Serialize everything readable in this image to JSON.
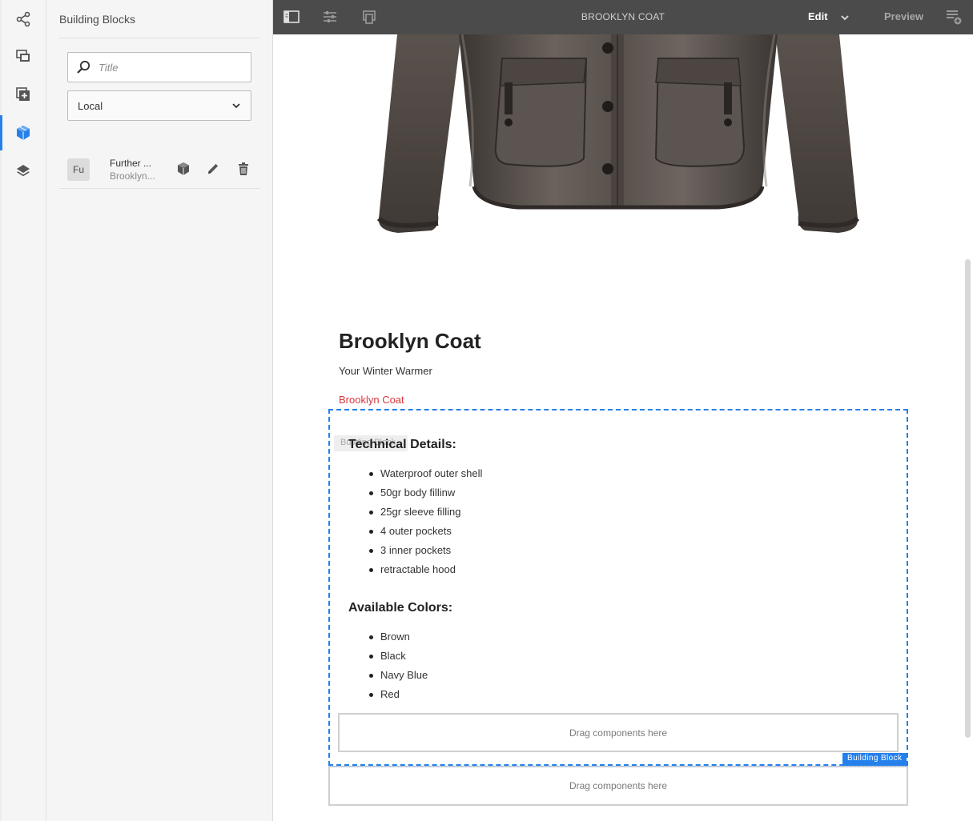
{
  "rail": {
    "items": [
      {
        "icon": "share-icon"
      },
      {
        "icon": "assets-icon"
      },
      {
        "icon": "add-component-icon"
      },
      {
        "icon": "building-blocks-icon",
        "active": true
      },
      {
        "icon": "layers-icon"
      }
    ]
  },
  "panel": {
    "title": "Building Blocks",
    "search_placeholder": "Title",
    "filter_value": "Local",
    "items": [
      {
        "thumb": "Fu",
        "title": "Further ...",
        "subtitle": "Brooklyn..."
      }
    ]
  },
  "topbar": {
    "page_title": "BROOKLYN COAT",
    "mode": "Edit",
    "preview": "Preview"
  },
  "content": {
    "title": "Brooklyn Coat",
    "subtitle": "Your Winter Warmer",
    "link": "Brooklyn Coat",
    "ghost_label": "Building Block",
    "tech_heading": "Technical Details:",
    "tech_items": [
      "Waterproof outer shell",
      "50gr body fillinw",
      "25gr sleeve filling",
      "4 outer pockets",
      "3 inner pockets",
      "retractable hood"
    ],
    "colors_heading": "Available Colors:",
    "color_items": [
      "Brown",
      "Black",
      "Navy Blue",
      "Red"
    ],
    "drop_inner": "Drag components here",
    "badge": "Building Block",
    "drop_outer": "Drag components here"
  },
  "colors": {
    "accent": "#2680eb",
    "link": "#d7373f",
    "topbar": "#4b4b4b"
  }
}
